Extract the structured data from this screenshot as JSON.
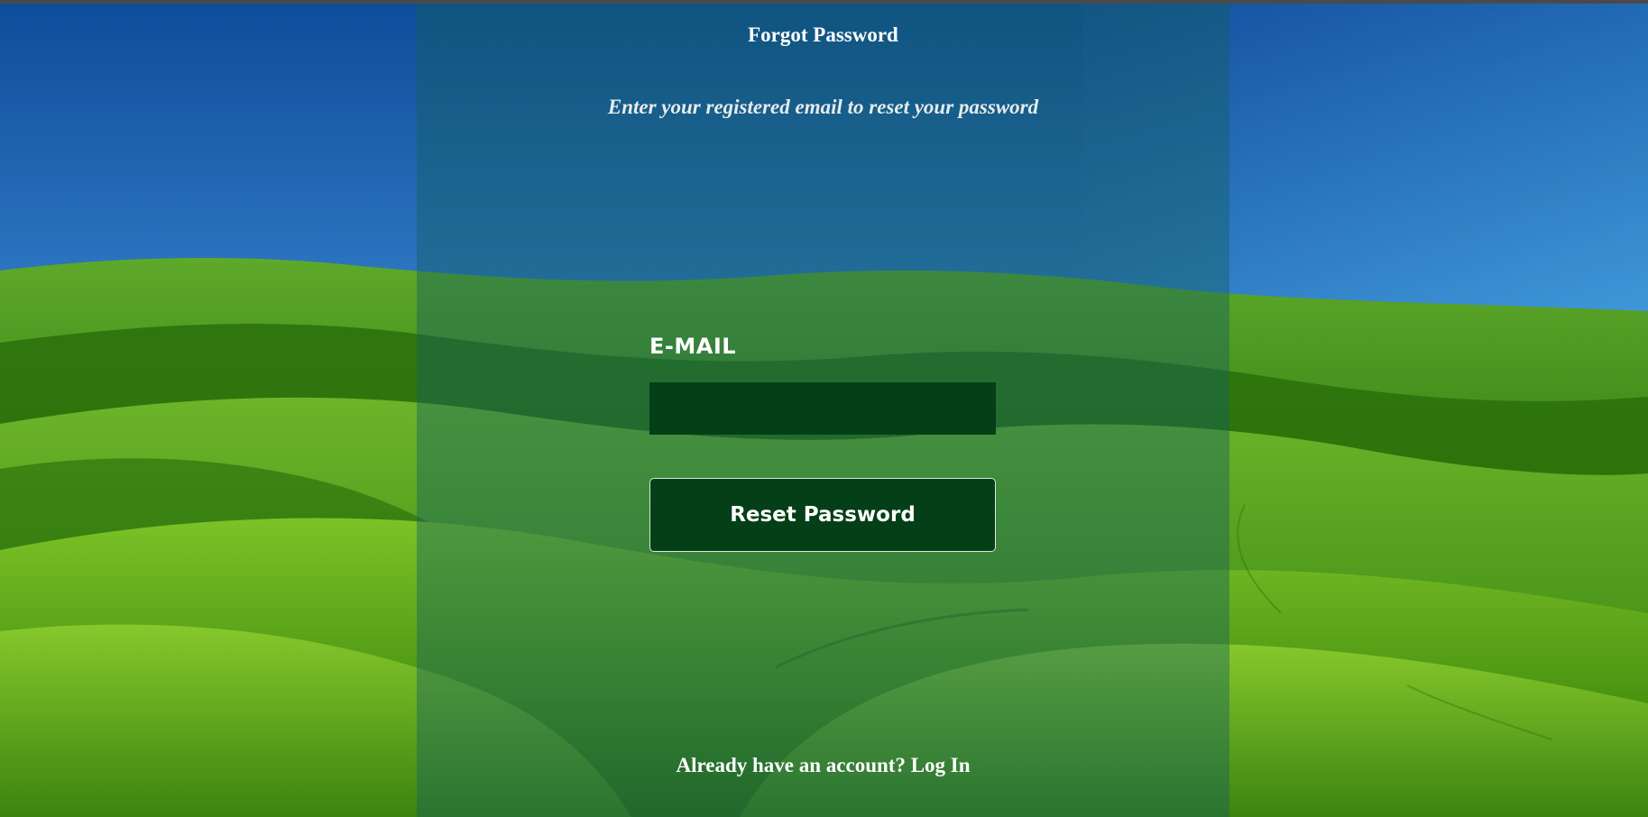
{
  "page": {
    "title": "Forgot Password",
    "subtitle": "Enter your registered email to reset your password"
  },
  "form": {
    "email_label": "E-MAIL",
    "email_value": "",
    "reset_button_label": "Reset Password"
  },
  "footer": {
    "prompt": "Already have an account?",
    "login_link": "Log In"
  },
  "colors": {
    "panel_overlay": "#145f5f",
    "input_bg": "#043f17",
    "button_bg": "#043f17",
    "text": "#ffffff",
    "sky_top": "#0d4f9c",
    "sky_bottom": "#86c6f0",
    "grass": "#3f8f12"
  }
}
